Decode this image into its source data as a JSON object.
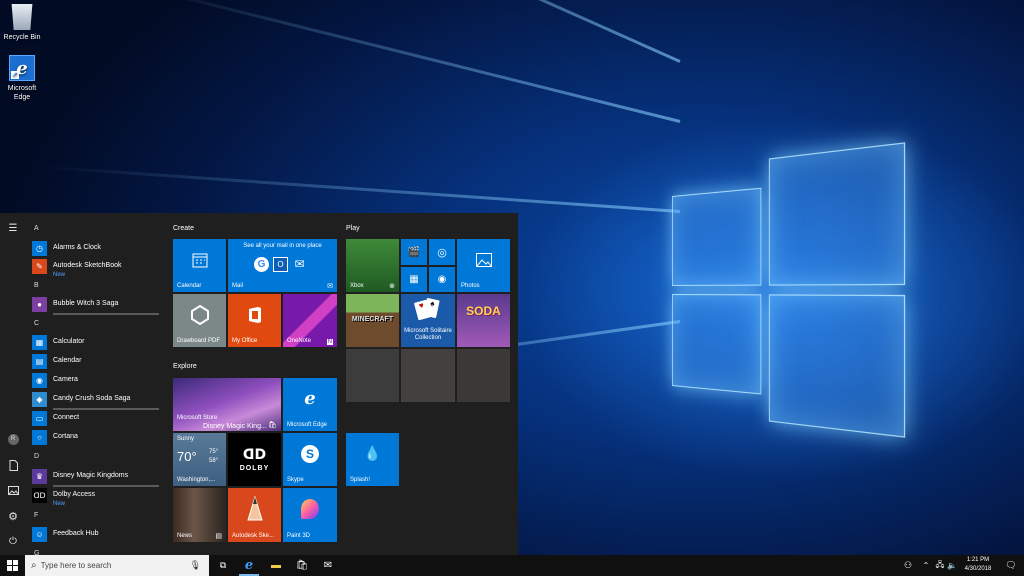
{
  "desktop": {
    "icons": [
      {
        "label": "Recycle Bin"
      },
      {
        "label": "Microsoft Edge"
      }
    ]
  },
  "start_menu": {
    "rail": {
      "avatar_letter": "R"
    },
    "apps": {
      "letters": [
        "A",
        "B",
        "C",
        "D",
        "F",
        "G"
      ],
      "items": [
        {
          "name": "Alarms & Clock"
        },
        {
          "name": "Autodesk SketchBook",
          "sub": "New"
        },
        {
          "name": "Bubble Witch 3 Saga"
        },
        {
          "name": "Calculator"
        },
        {
          "name": "Calendar"
        },
        {
          "name": "Camera"
        },
        {
          "name": "Candy Crush Soda Saga"
        },
        {
          "name": "Connect"
        },
        {
          "name": "Cortana"
        },
        {
          "name": "Disney Magic Kingdoms"
        },
        {
          "name": "Dolby Access",
          "sub": "New"
        },
        {
          "name": "Feedback Hub"
        }
      ]
    },
    "groups": {
      "create": "Create",
      "play": "Play",
      "explore": "Explore"
    },
    "tiles": {
      "calendar": "Calendar",
      "mail": "Mail",
      "mail_headline": "See all your mail in one place",
      "drawboard": "Drawboard PDF",
      "my_office": "My Office",
      "onenote": "OneNote",
      "xbox": "Xbox",
      "photos": "Photos",
      "minecraft_logo": "MINECRAFT",
      "solitaire": "Microsoft Solitaire Collection",
      "soda_logo": "SODA",
      "store": "Microsoft Store",
      "store_overlay": "Disney Magic King...",
      "edge": "Microsoft Edge",
      "weather_city": "Sunny",
      "weather_temp": "70°",
      "weather_hi": "75°",
      "weather_lo": "58°",
      "weather_place": "Washington,...",
      "dolby": "DOLBY",
      "skype": "Skype",
      "splash": "Splash!",
      "news": "News",
      "sketchbook": "Autodesk Ske...",
      "paint3d": "Paint 3D"
    }
  },
  "taskbar": {
    "search_placeholder": "Type here to search",
    "time": "1:21 PM",
    "date": "4/30/2018"
  },
  "colors": {
    "accent": "#0078d7",
    "menu_bg": "#1f1f1f",
    "taskbar_bg": "#101010"
  }
}
